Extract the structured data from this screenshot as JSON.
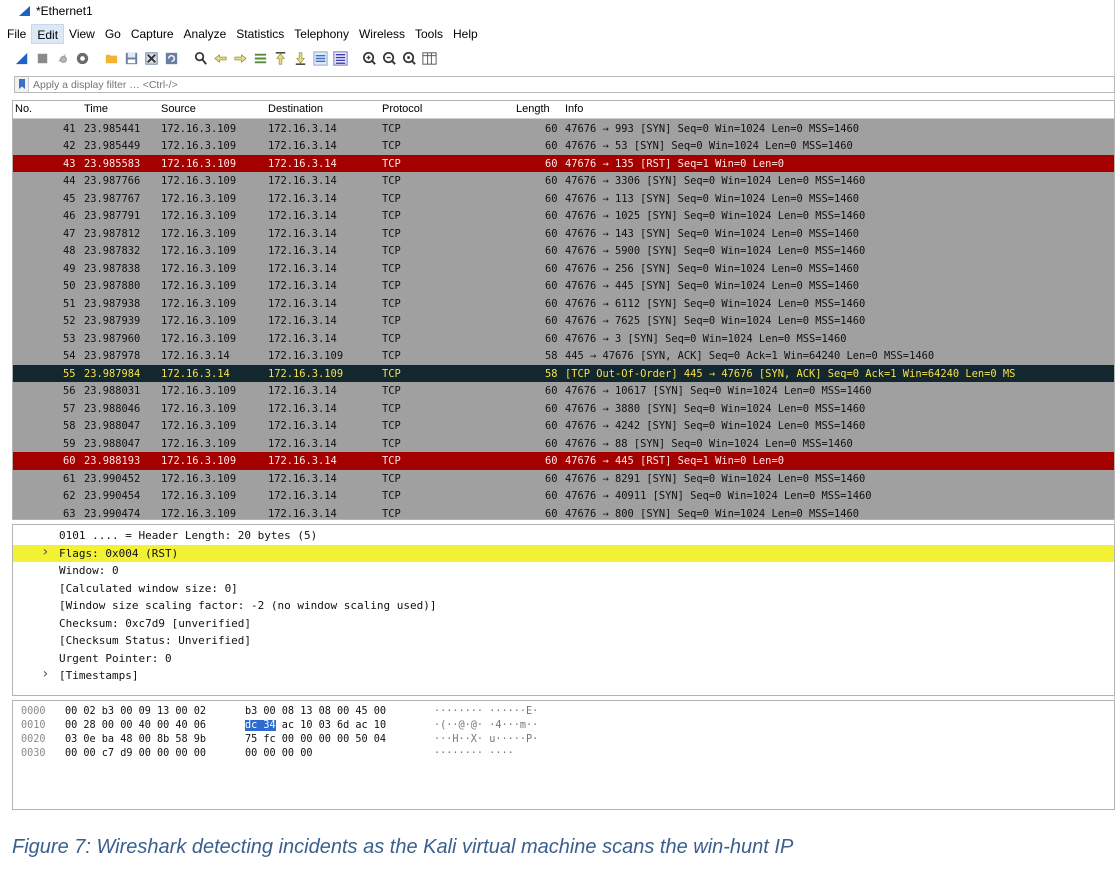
{
  "window": {
    "title": "*Ethernet1"
  },
  "menu": {
    "items": [
      "File",
      "Edit",
      "View",
      "Go",
      "Capture",
      "Analyze",
      "Statistics",
      "Telephony",
      "Wireless",
      "Tools",
      "Help"
    ],
    "active": "Edit"
  },
  "toolbar": {
    "icons": [
      "shark-fin-start-icon",
      "stop-square-icon",
      "restart-icon",
      "options-gear-icon",
      "open-folder-icon",
      "save-file-icon",
      "close-file-icon",
      "reload-file-icon",
      "find-packet-icon",
      "go-back-icon",
      "go-forward-icon",
      "go-to-packet-icon",
      "go-first-icon",
      "go-last-icon",
      "autoscroll-icon",
      "colorize-icon",
      "zoom-in-icon",
      "zoom-out-icon",
      "zoom-normal-icon",
      "resize-columns-icon"
    ]
  },
  "filter": {
    "placeholder": "Apply a display filter … <Ctrl-/>"
  },
  "packet_list": {
    "columns": [
      "No.",
      "Time",
      "Source",
      "Destination",
      "Protocol",
      "Length",
      "Info"
    ],
    "rows": [
      {
        "no": "41",
        "time": "23.985441",
        "source": "172.16.3.109",
        "destination": "172.16.3.14",
        "protocol": "TCP",
        "length": "60",
        "info": "47676 → 993 [SYN] Seq=0 Win=1024 Len=0 MSS=1460",
        "style": "normal"
      },
      {
        "no": "42",
        "time": "23.985449",
        "source": "172.16.3.109",
        "destination": "172.16.3.14",
        "protocol": "TCP",
        "length": "60",
        "info": "47676 → 53 [SYN] Seq=0 Win=1024 Len=0 MSS=1460",
        "style": "normal"
      },
      {
        "no": "43",
        "time": "23.985583",
        "source": "172.16.3.109",
        "destination": "172.16.3.14",
        "protocol": "TCP",
        "length": "60",
        "info": "47676 → 135 [RST] Seq=1 Win=0 Len=0",
        "style": "rst"
      },
      {
        "no": "44",
        "time": "23.987766",
        "source": "172.16.3.109",
        "destination": "172.16.3.14",
        "protocol": "TCP",
        "length": "60",
        "info": "47676 → 3306 [SYN] Seq=0 Win=1024 Len=0 MSS=1460",
        "style": "normal"
      },
      {
        "no": "45",
        "time": "23.987767",
        "source": "172.16.3.109",
        "destination": "172.16.3.14",
        "protocol": "TCP",
        "length": "60",
        "info": "47676 → 113 [SYN] Seq=0 Win=1024 Len=0 MSS=1460",
        "style": "normal"
      },
      {
        "no": "46",
        "time": "23.987791",
        "source": "172.16.3.109",
        "destination": "172.16.3.14",
        "protocol": "TCP",
        "length": "60",
        "info": "47676 → 1025 [SYN] Seq=0 Win=1024 Len=0 MSS=1460",
        "style": "normal"
      },
      {
        "no": "47",
        "time": "23.987812",
        "source": "172.16.3.109",
        "destination": "172.16.3.14",
        "protocol": "TCP",
        "length": "60",
        "info": "47676 → 143 [SYN] Seq=0 Win=1024 Len=0 MSS=1460",
        "style": "normal"
      },
      {
        "no": "48",
        "time": "23.987832",
        "source": "172.16.3.109",
        "destination": "172.16.3.14",
        "protocol": "TCP",
        "length": "60",
        "info": "47676 → 5900 [SYN] Seq=0 Win=1024 Len=0 MSS=1460",
        "style": "normal"
      },
      {
        "no": "49",
        "time": "23.987838",
        "source": "172.16.3.109",
        "destination": "172.16.3.14",
        "protocol": "TCP",
        "length": "60",
        "info": "47676 → 256 [SYN] Seq=0 Win=1024 Len=0 MSS=1460",
        "style": "normal"
      },
      {
        "no": "50",
        "time": "23.987880",
        "source": "172.16.3.109",
        "destination": "172.16.3.14",
        "protocol": "TCP",
        "length": "60",
        "info": "47676 → 445 [SYN] Seq=0 Win=1024 Len=0 MSS=1460",
        "style": "normal"
      },
      {
        "no": "51",
        "time": "23.987938",
        "source": "172.16.3.109",
        "destination": "172.16.3.14",
        "protocol": "TCP",
        "length": "60",
        "info": "47676 → 6112 [SYN] Seq=0 Win=1024 Len=0 MSS=1460",
        "style": "normal"
      },
      {
        "no": "52",
        "time": "23.987939",
        "source": "172.16.3.109",
        "destination": "172.16.3.14",
        "protocol": "TCP",
        "length": "60",
        "info": "47676 → 7625 [SYN] Seq=0 Win=1024 Len=0 MSS=1460",
        "style": "normal"
      },
      {
        "no": "53",
        "time": "23.987960",
        "source": "172.16.3.109",
        "destination": "172.16.3.14",
        "protocol": "TCP",
        "length": "60",
        "info": "47676 → 3 [SYN] Seq=0 Win=1024 Len=0 MSS=1460",
        "style": "normal"
      },
      {
        "no": "54",
        "time": "23.987978",
        "source": "172.16.3.14",
        "destination": "172.16.3.109",
        "protocol": "TCP",
        "length": "58",
        "info": "445 → 47676 [SYN, ACK] Seq=0 Ack=1 Win=64240 Len=0 MSS=1460",
        "style": "normal"
      },
      {
        "no": "55",
        "time": "23.987984",
        "source": "172.16.3.14",
        "destination": "172.16.3.109",
        "protocol": "TCP",
        "length": "58",
        "info": "[TCP Out-Of-Order] 445 → 47676 [SYN, ACK] Seq=0 Ack=1 Win=64240 Len=0 MS",
        "style": "selected"
      },
      {
        "no": "56",
        "time": "23.988031",
        "source": "172.16.3.109",
        "destination": "172.16.3.14",
        "protocol": "TCP",
        "length": "60",
        "info": "47676 → 10617 [SYN] Seq=0 Win=1024 Len=0 MSS=1460",
        "style": "normal"
      },
      {
        "no": "57",
        "time": "23.988046",
        "source": "172.16.3.109",
        "destination": "172.16.3.14",
        "protocol": "TCP",
        "length": "60",
        "info": "47676 → 3880 [SYN] Seq=0 Win=1024 Len=0 MSS=1460",
        "style": "normal"
      },
      {
        "no": "58",
        "time": "23.988047",
        "source": "172.16.3.109",
        "destination": "172.16.3.14",
        "protocol": "TCP",
        "length": "60",
        "info": "47676 → 4242 [SYN] Seq=0 Win=1024 Len=0 MSS=1460",
        "style": "normal"
      },
      {
        "no": "59",
        "time": "23.988047",
        "source": "172.16.3.109",
        "destination": "172.16.3.14",
        "protocol": "TCP",
        "length": "60",
        "info": "47676 → 88 [SYN] Seq=0 Win=1024 Len=0 MSS=1460",
        "style": "normal"
      },
      {
        "no": "60",
        "time": "23.988193",
        "source": "172.16.3.109",
        "destination": "172.16.3.14",
        "protocol": "TCP",
        "length": "60",
        "info": "47676 → 445 [RST] Seq=1 Win=0 Len=0",
        "style": "rst"
      },
      {
        "no": "61",
        "time": "23.990452",
        "source": "172.16.3.109",
        "destination": "172.16.3.14",
        "protocol": "TCP",
        "length": "60",
        "info": "47676 → 8291 [SYN] Seq=0 Win=1024 Len=0 MSS=1460",
        "style": "normal"
      },
      {
        "no": "62",
        "time": "23.990454",
        "source": "172.16.3.109",
        "destination": "172.16.3.14",
        "protocol": "TCP",
        "length": "60",
        "info": "47676 → 40911 [SYN] Seq=0 Win=1024 Len=0 MSS=1460",
        "style": "normal"
      },
      {
        "no": "63",
        "time": "23.990474",
        "source": "172.16.3.109",
        "destination": "172.16.3.14",
        "protocol": "TCP",
        "length": "60",
        "info": "47676 → 800 [SYN] Seq=0 Win=1024 Len=0 MSS=1460",
        "style": "normal"
      }
    ]
  },
  "details": {
    "lines": [
      {
        "text": "0101 .... = Header Length: 20 bytes (5)",
        "expandable": false,
        "highlight": false
      },
      {
        "text": "Flags: 0x004 (RST)",
        "expandable": true,
        "highlight": true
      },
      {
        "text": "Window: 0",
        "expandable": false,
        "highlight": false
      },
      {
        "text": "[Calculated window size: 0]",
        "expandable": false,
        "highlight": false
      },
      {
        "text": "[Window size scaling factor: -2 (no window scaling used)]",
        "expandable": false,
        "highlight": false
      },
      {
        "text": "Checksum: 0xc7d9 [unverified]",
        "expandable": false,
        "highlight": false
      },
      {
        "text": "[Checksum Status: Unverified]",
        "expandable": false,
        "highlight": false
      },
      {
        "text": "Urgent Pointer: 0",
        "expandable": false,
        "highlight": false
      },
      {
        "text": "[Timestamps]",
        "expandable": true,
        "highlight": false
      }
    ]
  },
  "bytes": {
    "rows": [
      {
        "offset": "0000",
        "hex1": "00 02 b3 00 09 13 00 02",
        "hex2_pre": "",
        "hex2_sel": "",
        "hex2": "b3 00 08 13 08 00 45 00",
        "ascii": "········ ······E·"
      },
      {
        "offset": "0010",
        "hex1": "00 28 00 00 40 00 40 06",
        "hex2_pre": "",
        "hex2_sel": "dc 34",
        "hex2": " ac 10 03 6d ac 10",
        "ascii": "·(··@·@· ·4···m··"
      },
      {
        "offset": "0020",
        "hex1": "03 0e ba 48 00 8b 58 9b",
        "hex2_pre": "",
        "hex2_sel": "",
        "hex2": "75 fc 00 00 00 00 50 04",
        "ascii": "···H··X· u·····P·"
      },
      {
        "offset": "0030",
        "hex1": "00 00 c7 d9 00 00 00 00",
        "hex2_pre": "",
        "hex2_sel": "",
        "hex2": "00 00 00 00",
        "ascii": "········ ····"
      }
    ]
  },
  "caption": "Figure 7: Wireshark detecting incidents as the Kali virtual machine scans the win-hunt IP",
  "colors": {
    "rst_row": "#a40000",
    "selected_row": "#12272e",
    "selected_text": "#f7e04b",
    "normal_row": "#a0a0a0",
    "highlight_line": "#f3f134",
    "caption": "#3a5f8e"
  }
}
